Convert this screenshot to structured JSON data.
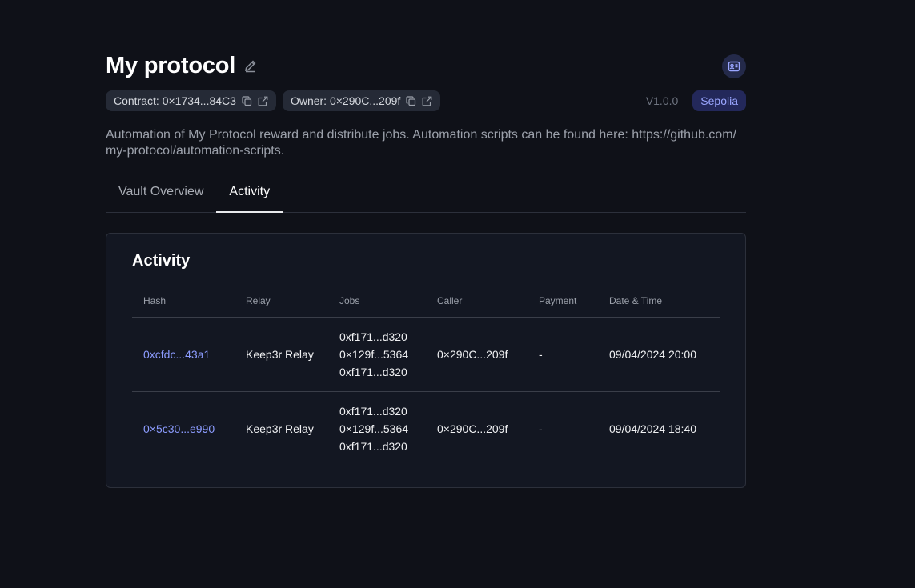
{
  "header": {
    "title": "My protocol",
    "contract_chip": "Contract: 0×1734...84C3",
    "owner_chip": "Owner: 0×290C...209f",
    "version": "V1.0.0",
    "network": "Sepolia"
  },
  "description": "Automation of My Protocol reward and distribute jobs. Automation scripts can be found here: https://github.com/my-protocol/automation-scripts.",
  "tabs": [
    {
      "label": "Vault Overview",
      "active": false
    },
    {
      "label": "Activity",
      "active": true
    }
  ],
  "activity": {
    "title": "Activity",
    "columns": [
      "Hash",
      "Relay",
      "Jobs",
      "Caller",
      "Payment",
      "Date & Time"
    ],
    "rows": [
      {
        "hash": "0xcfdc...43a1",
        "relay": "Keep3r Relay",
        "jobs": [
          "0xf171...d320",
          "0×129f...5364",
          "0xf171...d320"
        ],
        "caller": "0×290C...209f",
        "payment": "-",
        "datetime": "09/04/2024 20:00"
      },
      {
        "hash": "0×5c30...e990",
        "relay": "Keep3r Relay",
        "jobs": [
          "0xf171...d320",
          "0×129f...5364",
          "0xf171...d320"
        ],
        "caller": "0×290C...209f",
        "payment": "-",
        "datetime": "09/04/2024 18:40"
      }
    ]
  },
  "icons": {
    "edit": "pencil-icon",
    "copy": "copy-icon",
    "external": "external-link-icon",
    "top_right": "id-card-icon"
  },
  "colors": {
    "background": "#0f1118",
    "panel": "#131722",
    "accent": "#8c9cff",
    "network_badge_bg": "#23285a"
  }
}
